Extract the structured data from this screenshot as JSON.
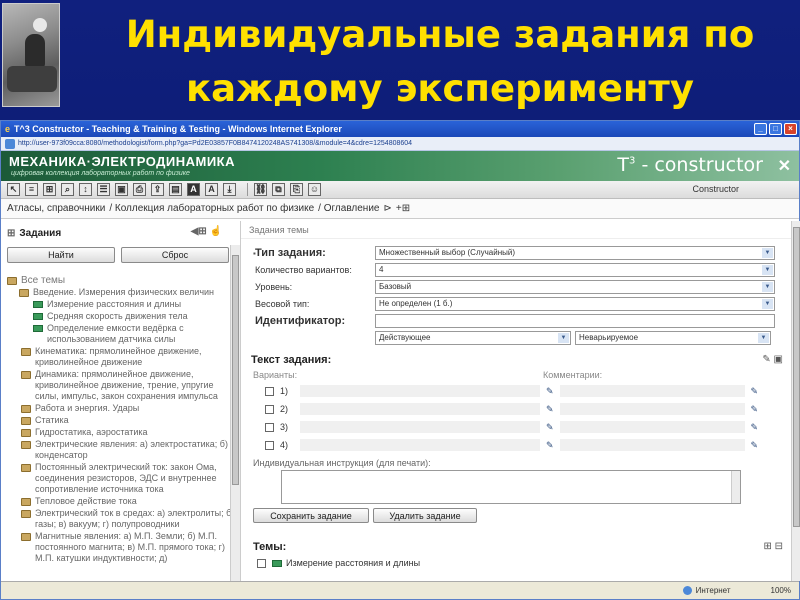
{
  "slide": {
    "title_line1": "Индивидуальные задания по",
    "title_line2": "каждому эксперименту"
  },
  "browser": {
    "window_title": "T^3 Constructor - Teaching & Training & Testing - Windows Internet Explorer",
    "address": "http://user-973f09cca:8080/methodologist/form.php?ga=Pd2E03857F0B8474120248AS741308/&module=4&cdre=1254808604"
  },
  "app": {
    "logo": "МЕХАНИКА·ЭЛЕКТРОДИНАМИКА",
    "logo_sub": "цифровая коллекция лабораторных работ по физике",
    "brand": "T",
    "brand_sup": "3",
    "brand_suffix": " - constructor",
    "toolbar_label": "Constructor"
  },
  "breadcrumb": {
    "items": [
      "Атласы, справочники",
      "/ Коллекция лабораторных работ по физике",
      "/ Оглавление"
    ]
  },
  "left": {
    "header": "Задания",
    "find_button": "Найти",
    "reset_button": "Сброс",
    "tree": [
      {
        "level": "root",
        "label": "Все темы",
        "type": "folder"
      },
      {
        "level": "l1",
        "label": "Введение. Измерения физических величин",
        "type": "folder"
      },
      {
        "level": "l2",
        "label": "Измерение расстояния и длины",
        "type": "leaf"
      },
      {
        "level": "l2",
        "label": "Средняя скорость движения тела",
        "type": "leaf"
      },
      {
        "level": "l2",
        "label": "Определение емкости ведёрка с использованием датчика силы",
        "type": "leaf"
      },
      {
        "level": "l1b",
        "label": "Кинематика: прямолинейное движение, криволинейное движение",
        "type": "folder"
      },
      {
        "level": "l1b",
        "label": "Динамика: прямолинейное движение, криволинейное движение, трение, упругие силы, импульс, закон сохранения импульса",
        "type": "folder"
      },
      {
        "level": "l1b",
        "label": "Работа и энергия. Удары",
        "type": "folder"
      },
      {
        "level": "l1b",
        "label": "Статика",
        "type": "folder"
      },
      {
        "level": "l1b",
        "label": "Гидростатика, аэростатика",
        "type": "folder"
      },
      {
        "level": "l1b",
        "label": "Электрические явления: а) электростатика; б) конденсатор",
        "type": "folder"
      },
      {
        "level": "l1b",
        "label": "Постоянный электрический ток: закон Ома, соединения резисторов, ЭДС и внутреннее сопротивление источника тока",
        "type": "folder"
      },
      {
        "level": "l1b",
        "label": "Тепловое действие тока",
        "type": "folder"
      },
      {
        "level": "l1b",
        "label": "Электрический ток в средах: а) электролиты; б) газы; в) вакуум; г) полупроводники",
        "type": "folder"
      },
      {
        "level": "l1b",
        "label": "Магнитные явления: а) М.П. Земли; б) М.П. постоянного магнита; в) М.П. прямого тока; г) М.П. катушки индуктивности; д)",
        "type": "folder"
      }
    ]
  },
  "right": {
    "section_title": "Задания темы",
    "task_type_label": "Тип задания:",
    "task_type_value": "Множественный выбор (Случайный)",
    "variants_count_label": "Количество вариантов:",
    "variants_count_value": "4",
    "level_label": "Уровень:",
    "level_value": "Базовый",
    "weight_label": "Весовой тип:",
    "weight_value": "Не определен (1 б.)",
    "identifier_label": "Идентификатор:",
    "status_value": "Действующее",
    "variation_value": "Неварьируемое",
    "task_text_label": "Текст задания:",
    "variants_label": "Варианты:",
    "comments_label": "Комментарии:",
    "variants": [
      "1)",
      "2)",
      "3)",
      "4)"
    ],
    "instruction_label": "Индивидуальная инструкция (для печати):",
    "save_button": "Сохранить задание",
    "delete_button": "Удалить задание",
    "themes_label": "Темы:",
    "themes": [
      "Измерение расстояния и длины"
    ]
  },
  "status": {
    "zone": "Интернет",
    "zoom": "100%"
  },
  "colors": {
    "slide_bg": "#0a1a6e",
    "title": "#ffe000",
    "app_header": "#2d8050",
    "ie_title": "#2a63d8"
  }
}
